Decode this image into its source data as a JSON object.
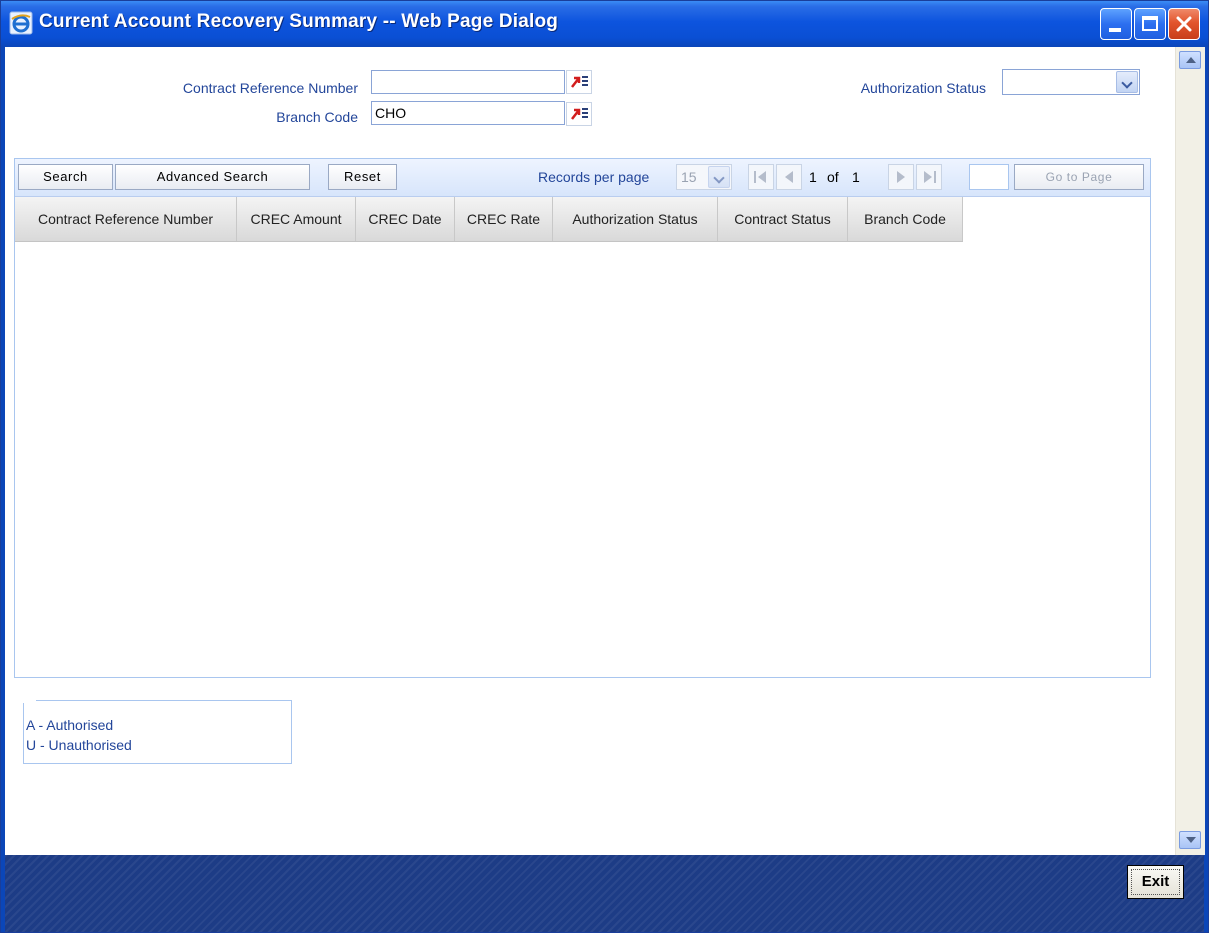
{
  "window": {
    "title": "Current Account Recovery Summary -- Web Page Dialog",
    "controls": [
      "minimize-icon",
      "maximize-icon",
      "close-icon"
    ]
  },
  "form": {
    "contract_ref_label": "Contract Reference Number",
    "contract_ref_value": "",
    "branch_code_label": "Branch Code",
    "branch_code_value": "CHO",
    "auth_status_label": "Authorization Status",
    "auth_status_value": ""
  },
  "toolbar": {
    "search_label": "Search",
    "advanced_search_label": "Advanced Search",
    "reset_label": "Reset",
    "records_per_page_label": "Records per page",
    "records_per_page_value": "15",
    "current_page": "1",
    "of_label": "of",
    "total_pages": "1",
    "goto_page_label": "Go to Page"
  },
  "grid": {
    "columns": [
      "Contract Reference Number",
      "CREC Amount",
      "CREC Date",
      "CREC Rate",
      "Authorization Status",
      "Contract Status",
      "Branch Code"
    ],
    "rows": []
  },
  "legend": {
    "lines": [
      "A - Authorised",
      "U - Unauthorised"
    ]
  },
  "footer": {
    "exit_label": "Exit"
  },
  "colors": {
    "titlebar": "#0d54de",
    "label_text": "#23469a",
    "panel_border": "#a9c6ef",
    "footer_bg": "#1d3c86"
  }
}
